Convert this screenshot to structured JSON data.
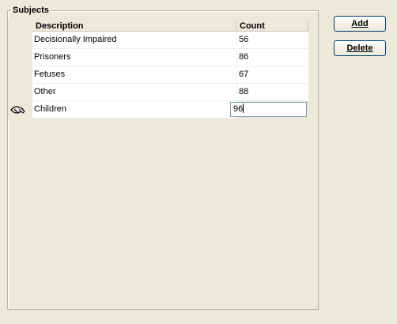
{
  "groupbox": {
    "title": "Subjects"
  },
  "grid": {
    "columns": [
      "Description",
      "Count"
    ],
    "rows": [
      {
        "description": "Decisionally Impaired",
        "count": "56"
      },
      {
        "description": "Prisoners",
        "count": "86"
      },
      {
        "description": "Fetuses",
        "count": "67"
      },
      {
        "description": "Other",
        "count": "88"
      },
      {
        "description": "Children",
        "count": "96"
      }
    ],
    "editing_row_icon": "edit-pencil-icon"
  },
  "buttons": {
    "add_label": "Add",
    "delete_label": "Delete"
  }
}
